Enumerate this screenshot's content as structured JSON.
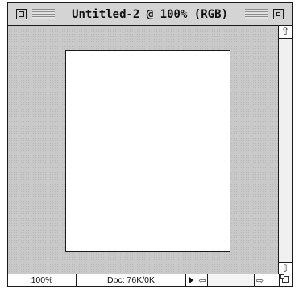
{
  "window": {
    "title": "Untitled-2 @ 100% (RGB)"
  },
  "statusbar": {
    "zoom": "100%",
    "doc_size": "Doc: 76K/0K"
  },
  "icons": {
    "close_box": "close-box-icon",
    "zoom_box": "zoom-box-icon",
    "scroll_up": "arrow-up-icon",
    "scroll_down": "arrow-down-icon",
    "scroll_left": "arrow-left-icon",
    "scroll_right": "arrow-right-icon",
    "popup": "triangle-right-icon",
    "grow": "size-box-icon"
  },
  "colors": {
    "canvas_bg": "#c9c9c9",
    "document": "#ffffff",
    "titlebar": "#d4d4d4"
  }
}
